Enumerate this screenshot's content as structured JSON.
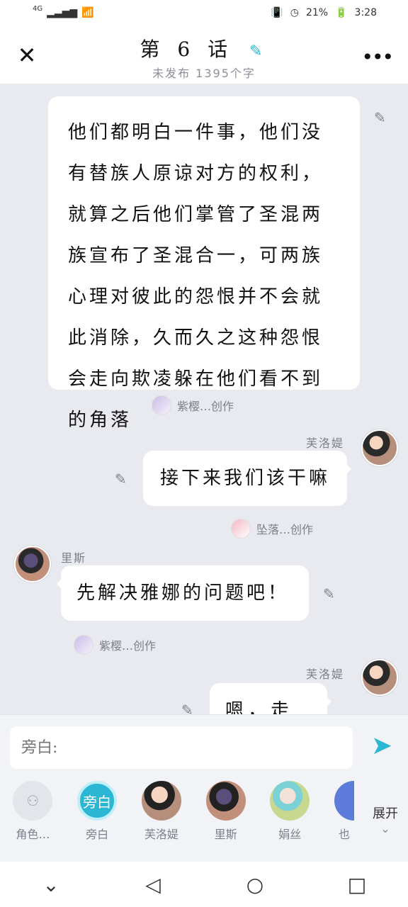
{
  "status_bar": {
    "network": "4G",
    "battery_percent": "21%",
    "time": "3:28"
  },
  "header": {
    "title": "第 6 话",
    "subtitle": "未发布 1395个字"
  },
  "messages": [
    {
      "kind": "narration",
      "text": "他们都明白一件事，他们没有替族人原谅对方的权利，就算之后他们掌管了圣混两族宣布了圣混合一，可两族心理对彼此的怨恨并不会就此消除，久而久之这种怨恨会走向欺凌躲在他们看不到的角落",
      "credit": "紫樱…创作"
    },
    {
      "kind": "right",
      "speaker": "芙洛媞",
      "text": "接下来我们该干嘛",
      "credit": "坠落…创作"
    },
    {
      "kind": "left",
      "speaker": "里斯",
      "text": "先解决雅娜的问题吧！",
      "credit": "紫樱…创作"
    },
    {
      "kind": "right",
      "speaker": "芙洛媞",
      "text": "嗯，走吧！"
    }
  ],
  "composer": {
    "placeholder": "旁白:"
  },
  "roles": [
    {
      "name": "角色…"
    },
    {
      "name": "旁白",
      "avatar_text": "旁白"
    },
    {
      "name": "芙洛媞"
    },
    {
      "name": "里斯"
    },
    {
      "name": "娟丝"
    },
    {
      "name": "也"
    }
  ],
  "expand_label": "展开",
  "colors": {
    "accent": "#2bb6d3",
    "background": "#e9eaef"
  }
}
